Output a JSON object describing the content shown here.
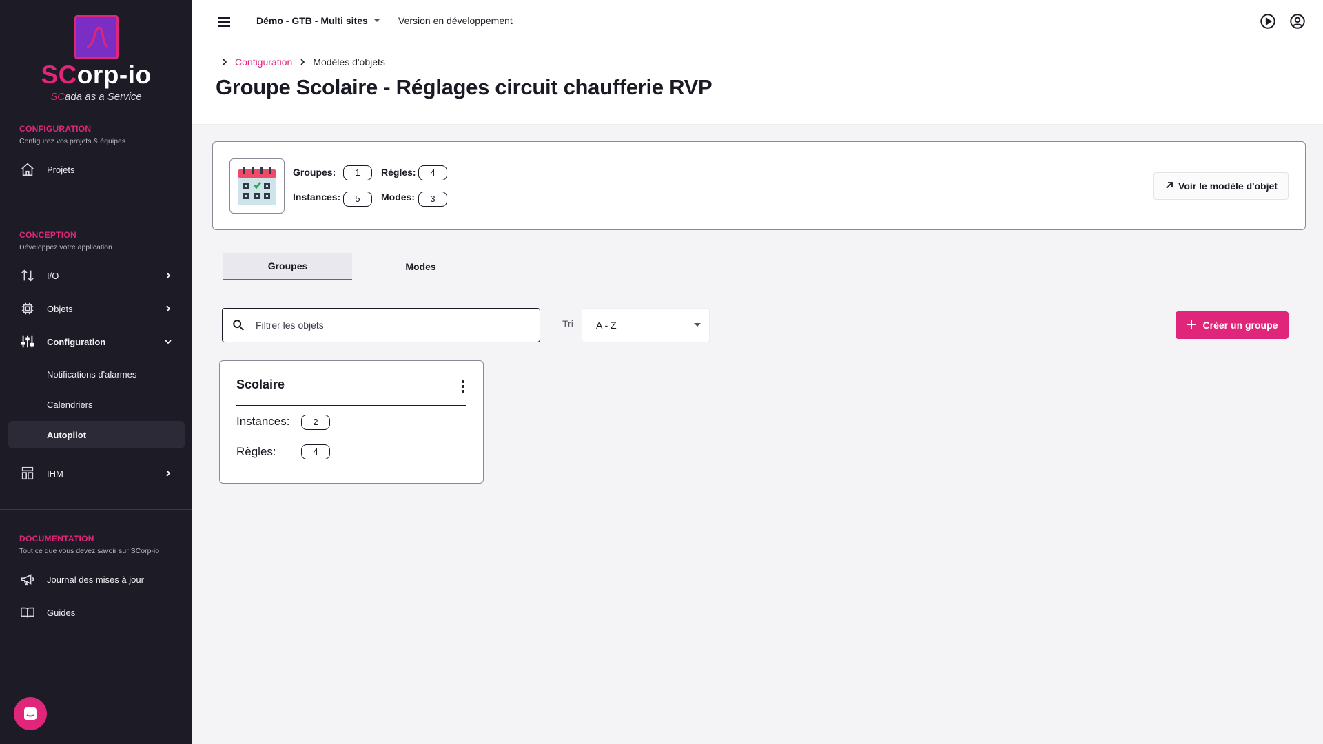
{
  "brand": {
    "name_prefix": "SC",
    "name_rest": "orp-io",
    "tagline_prefix": "SC",
    "tagline_rest": "ada as a Service",
    "accent": "#e0267a"
  },
  "sidebar": {
    "sections": [
      {
        "title": "CONFIGURATION",
        "subtitle": "Configurez vos projets & équipes"
      },
      {
        "title": "CONCEPTION",
        "subtitle": "Développez votre application"
      },
      {
        "title": "DOCUMENTATION",
        "subtitle": "Tout ce que vous devez savoir sur SCorp-io"
      }
    ],
    "items": {
      "projets": {
        "label": "Projets",
        "icon": "home-icon"
      },
      "io": {
        "label": "I/O",
        "icon": "arrows-updown-icon"
      },
      "objets": {
        "label": "Objets",
        "icon": "chip-icon"
      },
      "configuration": {
        "label": "Configuration",
        "icon": "sliders-icon",
        "expanded": true
      },
      "notifications": {
        "label": "Notifications d'alarmes"
      },
      "calendriers": {
        "label": "Calendriers"
      },
      "autopilot": {
        "label": "Autopilot",
        "active": true
      },
      "ihm": {
        "label": "IHM",
        "icon": "layout-icon"
      },
      "journal": {
        "label": "Journal des mises à jour",
        "icon": "megaphone-icon"
      },
      "guides": {
        "label": "Guides",
        "icon": "book-icon"
      }
    }
  },
  "topbar": {
    "project": "Démo - GTB - Multi sites",
    "version": "Version en développement"
  },
  "breadcrumb": {
    "parent": "Configuration",
    "current": "Modèles d'objets"
  },
  "page": {
    "title": "Groupe Scolaire - Réglages circuit chaufferie RVP"
  },
  "summary": {
    "groups_label": "Groupes:",
    "groups_value": "1",
    "rules_label": "Règles:",
    "rules_value": "4",
    "instances_label": "Instances:",
    "instances_value": "5",
    "modes_label": "Modes:",
    "modes_value": "3",
    "view_button": "Voir le modèle d'objet"
  },
  "tabs": [
    {
      "label": "Groupes",
      "active": true
    },
    {
      "label": "Modes",
      "active": false
    }
  ],
  "filters": {
    "search_placeholder": "Filtrer les objets",
    "sort_label": "Tri",
    "sort_value": "A - Z",
    "create_button": "Créer un groupe"
  },
  "groups": [
    {
      "title": "Scolaire",
      "instances_label": "Instances:",
      "instances_value": "2",
      "rules_label": "Règles:",
      "rules_value": "4"
    }
  ]
}
